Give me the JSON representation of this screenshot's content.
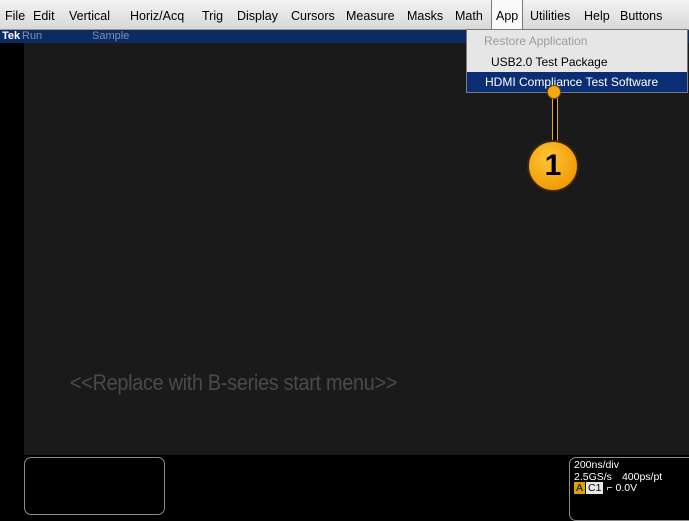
{
  "menubar": {
    "items": [
      "File",
      "Edit",
      "Vertical",
      "Horiz/Acq",
      "Trig",
      "Display",
      "Cursors",
      "Measure",
      "Masks",
      "Math",
      "App",
      "Utilities",
      "Help",
      "Buttons"
    ],
    "active": "App"
  },
  "status": {
    "brand": "Tek",
    "run_state": "Run",
    "acq_mode": "Sample"
  },
  "app_menu": {
    "items": [
      "Restore Application",
      "USB2.0 Test Package",
      "HDMI Compliance Test Software"
    ],
    "selected": "HDMI Compliance Test Software"
  },
  "callout": {
    "number": "1"
  },
  "graticule": {
    "placeholder_text": "<<Replace with B-series start menu>>"
  },
  "readout": {
    "horiz_scale": "200ns/div",
    "sample_rate": "2.5GS/s",
    "record_res": "400ps/pt",
    "trig_mode": "A",
    "trig_source": "C1",
    "trig_slope_symbol": "⌐",
    "trig_level": "0.0V"
  },
  "colors": {
    "accent_highlight": "#0b2d74",
    "callout": "#f5aa10",
    "status_bar": "#0b2b63"
  }
}
